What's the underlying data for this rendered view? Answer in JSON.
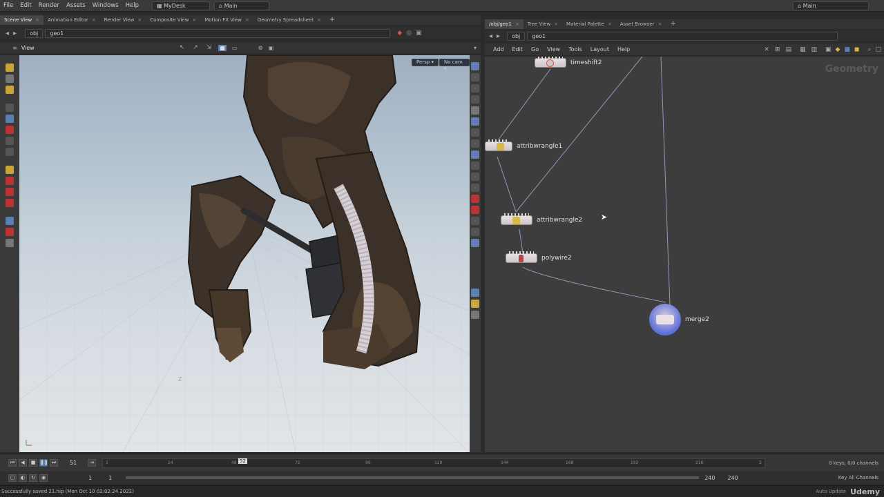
{
  "menubar": {
    "items": [
      "File",
      "Edit",
      "Render",
      "Assets",
      "Windows",
      "Help"
    ],
    "desktop": "MyDesk",
    "context": "Main",
    "right_context": "Main"
  },
  "left_tabs": [
    "Scene View",
    "Animation Editor",
    "Render View",
    "Composite View",
    "Motion FX View",
    "Geometry Spreadsheet"
  ],
  "left_path": [
    "obj",
    "geo1"
  ],
  "viewport": {
    "title": "View",
    "persp": "Persp",
    "cam": "No cam"
  },
  "right_tabs": [
    "/obj/geo1",
    "Tree View",
    "Material Palette",
    "Asset Browser"
  ],
  "right_path": [
    "obj",
    "geo1"
  ],
  "network_menu": [
    "Add",
    "Edit",
    "Go",
    "View",
    "Tools",
    "Layout",
    "Help"
  ],
  "network_context_label": "Geometry",
  "nodes": {
    "timeshift": "timeshift2",
    "wrangle1": "attribwrangle1",
    "wrangle2": "attribwrangle2",
    "polywire": "polywire2",
    "merge": "merge2"
  },
  "timeline": {
    "current_frame": "51",
    "playhead_frame": "52",
    "ticks": [
      "1",
      "24",
      "48",
      "72",
      "96",
      "120",
      "144",
      "168",
      "192",
      "216",
      "2"
    ],
    "start": "1",
    "start2": "1",
    "end": "240",
    "end2": "240",
    "keys_info": "0 keys, 0/0 channels",
    "key_all": "Key All Channels",
    "auto_update": "Auto Update"
  },
  "status": {
    "message": "Successfully saved 21.hip (Mon Oct 10 02:02:24 2022)",
    "watermark": "Udemy"
  },
  "colors": {
    "accent_blue": "#5a7fb0",
    "node_core": "#d9b84a",
    "merge_blue": "#5b6fd6"
  }
}
